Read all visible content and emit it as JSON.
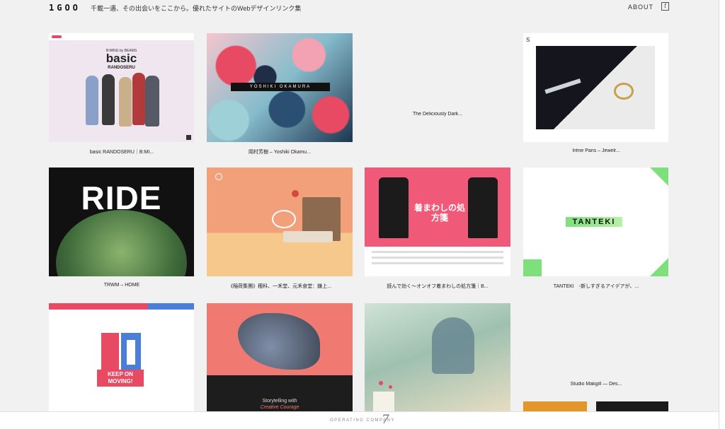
{
  "header": {
    "logo": "1GOO",
    "tagline": "千載一遇、その出会いをここから。優れたサイトのWebデザインリンク集",
    "about_label": "ABOUT",
    "facebook_icon": "f"
  },
  "cards": [
    {
      "caption": "basic RANDOSERU｜B:MI...",
      "title_line1": "B:MING by BEAMS",
      "title_line2": "basic",
      "title_line3": "RANDOSERU"
    },
    {
      "caption": "岡村芳樹 – Yoshiki Okamu...",
      "band_text": "YOSHIKI  OKAMURA"
    },
    {
      "caption": "The Deliciously Dark..."
    },
    {
      "caption": "Irène Paris – Jewelr..."
    },
    {
      "caption": "TRWM – HOME",
      "big_text": "RIDE"
    },
    {
      "caption": "《稲荷集團》穂科、一禾堂、元禾食堂：鎌上..."
    },
    {
      "caption": "読んで効く～オンオフ着まわしの処方箋｜B...",
      "big_text": "着まわしの処方箋"
    },
    {
      "caption": "TANTEKI　-新しすぎるアイデアが、...",
      "big_text": "TANTEKI"
    },
    {
      "caption": "",
      "big_text": "KEEP ON MOVING!"
    },
    {
      "caption": "",
      "line1": "Storytelling with",
      "line2": "Creative Courage"
    },
    {
      "caption": ""
    },
    {
      "caption": "Studio Makgill — Des..."
    }
  ],
  "footer": {
    "label": "OPERATING COMPANY",
    "mark": "7"
  },
  "colors": {
    "background": "#f1f1f1",
    "accent_red": "#e84a63",
    "accent_green": "#7de07a"
  }
}
